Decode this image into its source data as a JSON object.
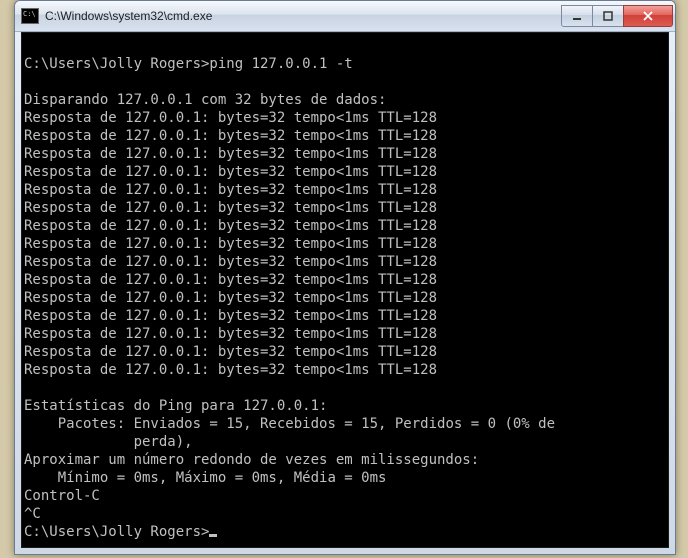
{
  "window": {
    "title": "C:\\Windows\\system32\\cmd.exe"
  },
  "terminal": {
    "prompt1": "C:\\Users\\Jolly Rogers>ping 127.0.0.1 -t",
    "header": "Disparando 127.0.0.1 com 32 bytes de dados:",
    "reply": "Resposta de 127.0.0.1: bytes=32 tempo<1ms TTL=128",
    "reply_count": 15,
    "stats_title": "Estatísticas do Ping para 127.0.0.1:",
    "stats_packets": "    Pacotes: Enviados = 15, Recebidos = 15, Perdidos = 0 (0% de",
    "stats_packets2": "             perda),",
    "stats_approx": "Aproximar um número redondo de vezes em milissegundos:",
    "stats_times": "    Mínimo = 0ms, Máximo = 0ms, Média = 0ms",
    "ctrlc": "Control-C",
    "caret": "^C",
    "prompt2": "C:\\Users\\Jolly Rogers>"
  }
}
